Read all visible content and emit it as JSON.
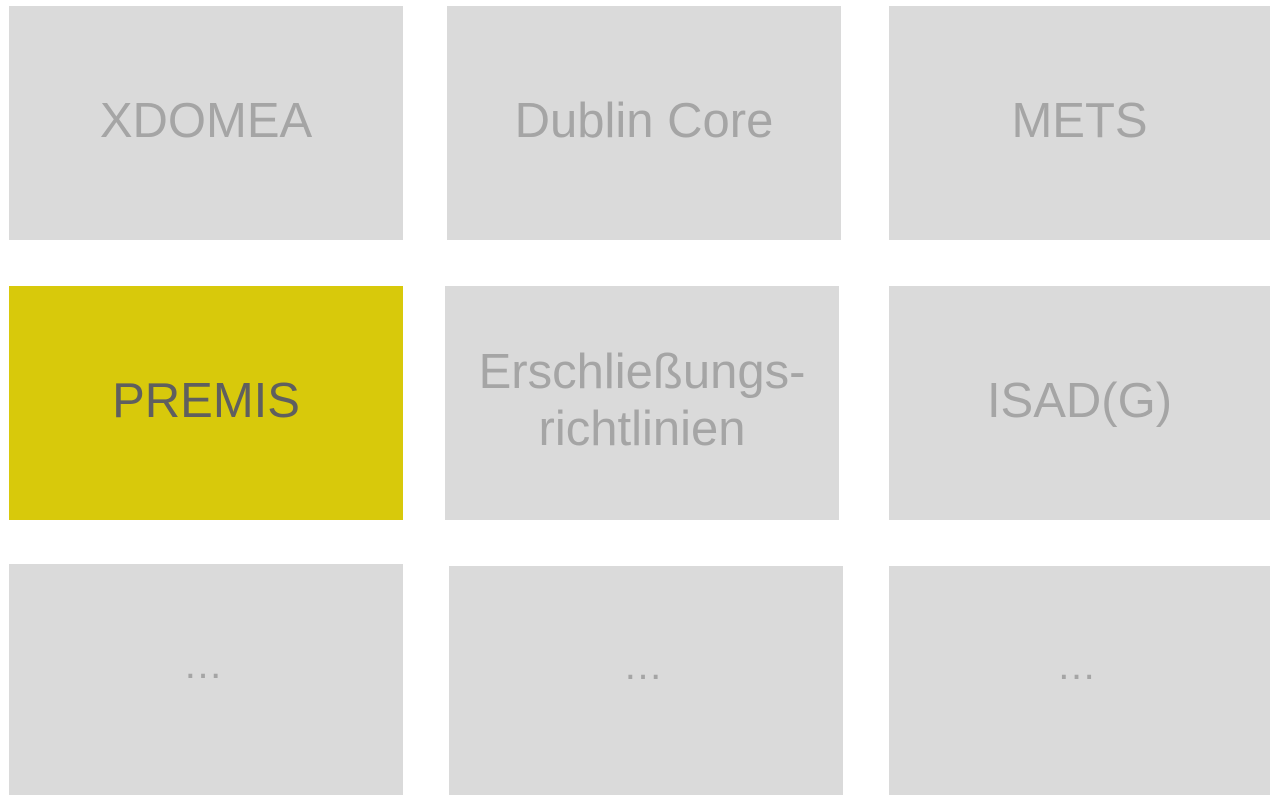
{
  "tiles": [
    {
      "label": "XDOMEA",
      "active": false
    },
    {
      "label": "Dublin Core",
      "active": false
    },
    {
      "label": "METS",
      "active": false
    },
    {
      "label": "PREMIS",
      "active": true
    },
    {
      "label_line1": "Erschließungs-",
      "label_line2": "richtlinien",
      "active": false
    },
    {
      "label": "ISAD(G)",
      "active": false
    },
    {
      "label": "…",
      "active": false
    },
    {
      "label": "…",
      "active": false
    },
    {
      "label": "…",
      "active": false
    }
  ],
  "colors": {
    "tile_background": "#dadada",
    "tile_text": "#a5a5a5",
    "active_background": "#d8c90b",
    "active_text": "#5f5f5f",
    "page_background": "#ffffff"
  }
}
